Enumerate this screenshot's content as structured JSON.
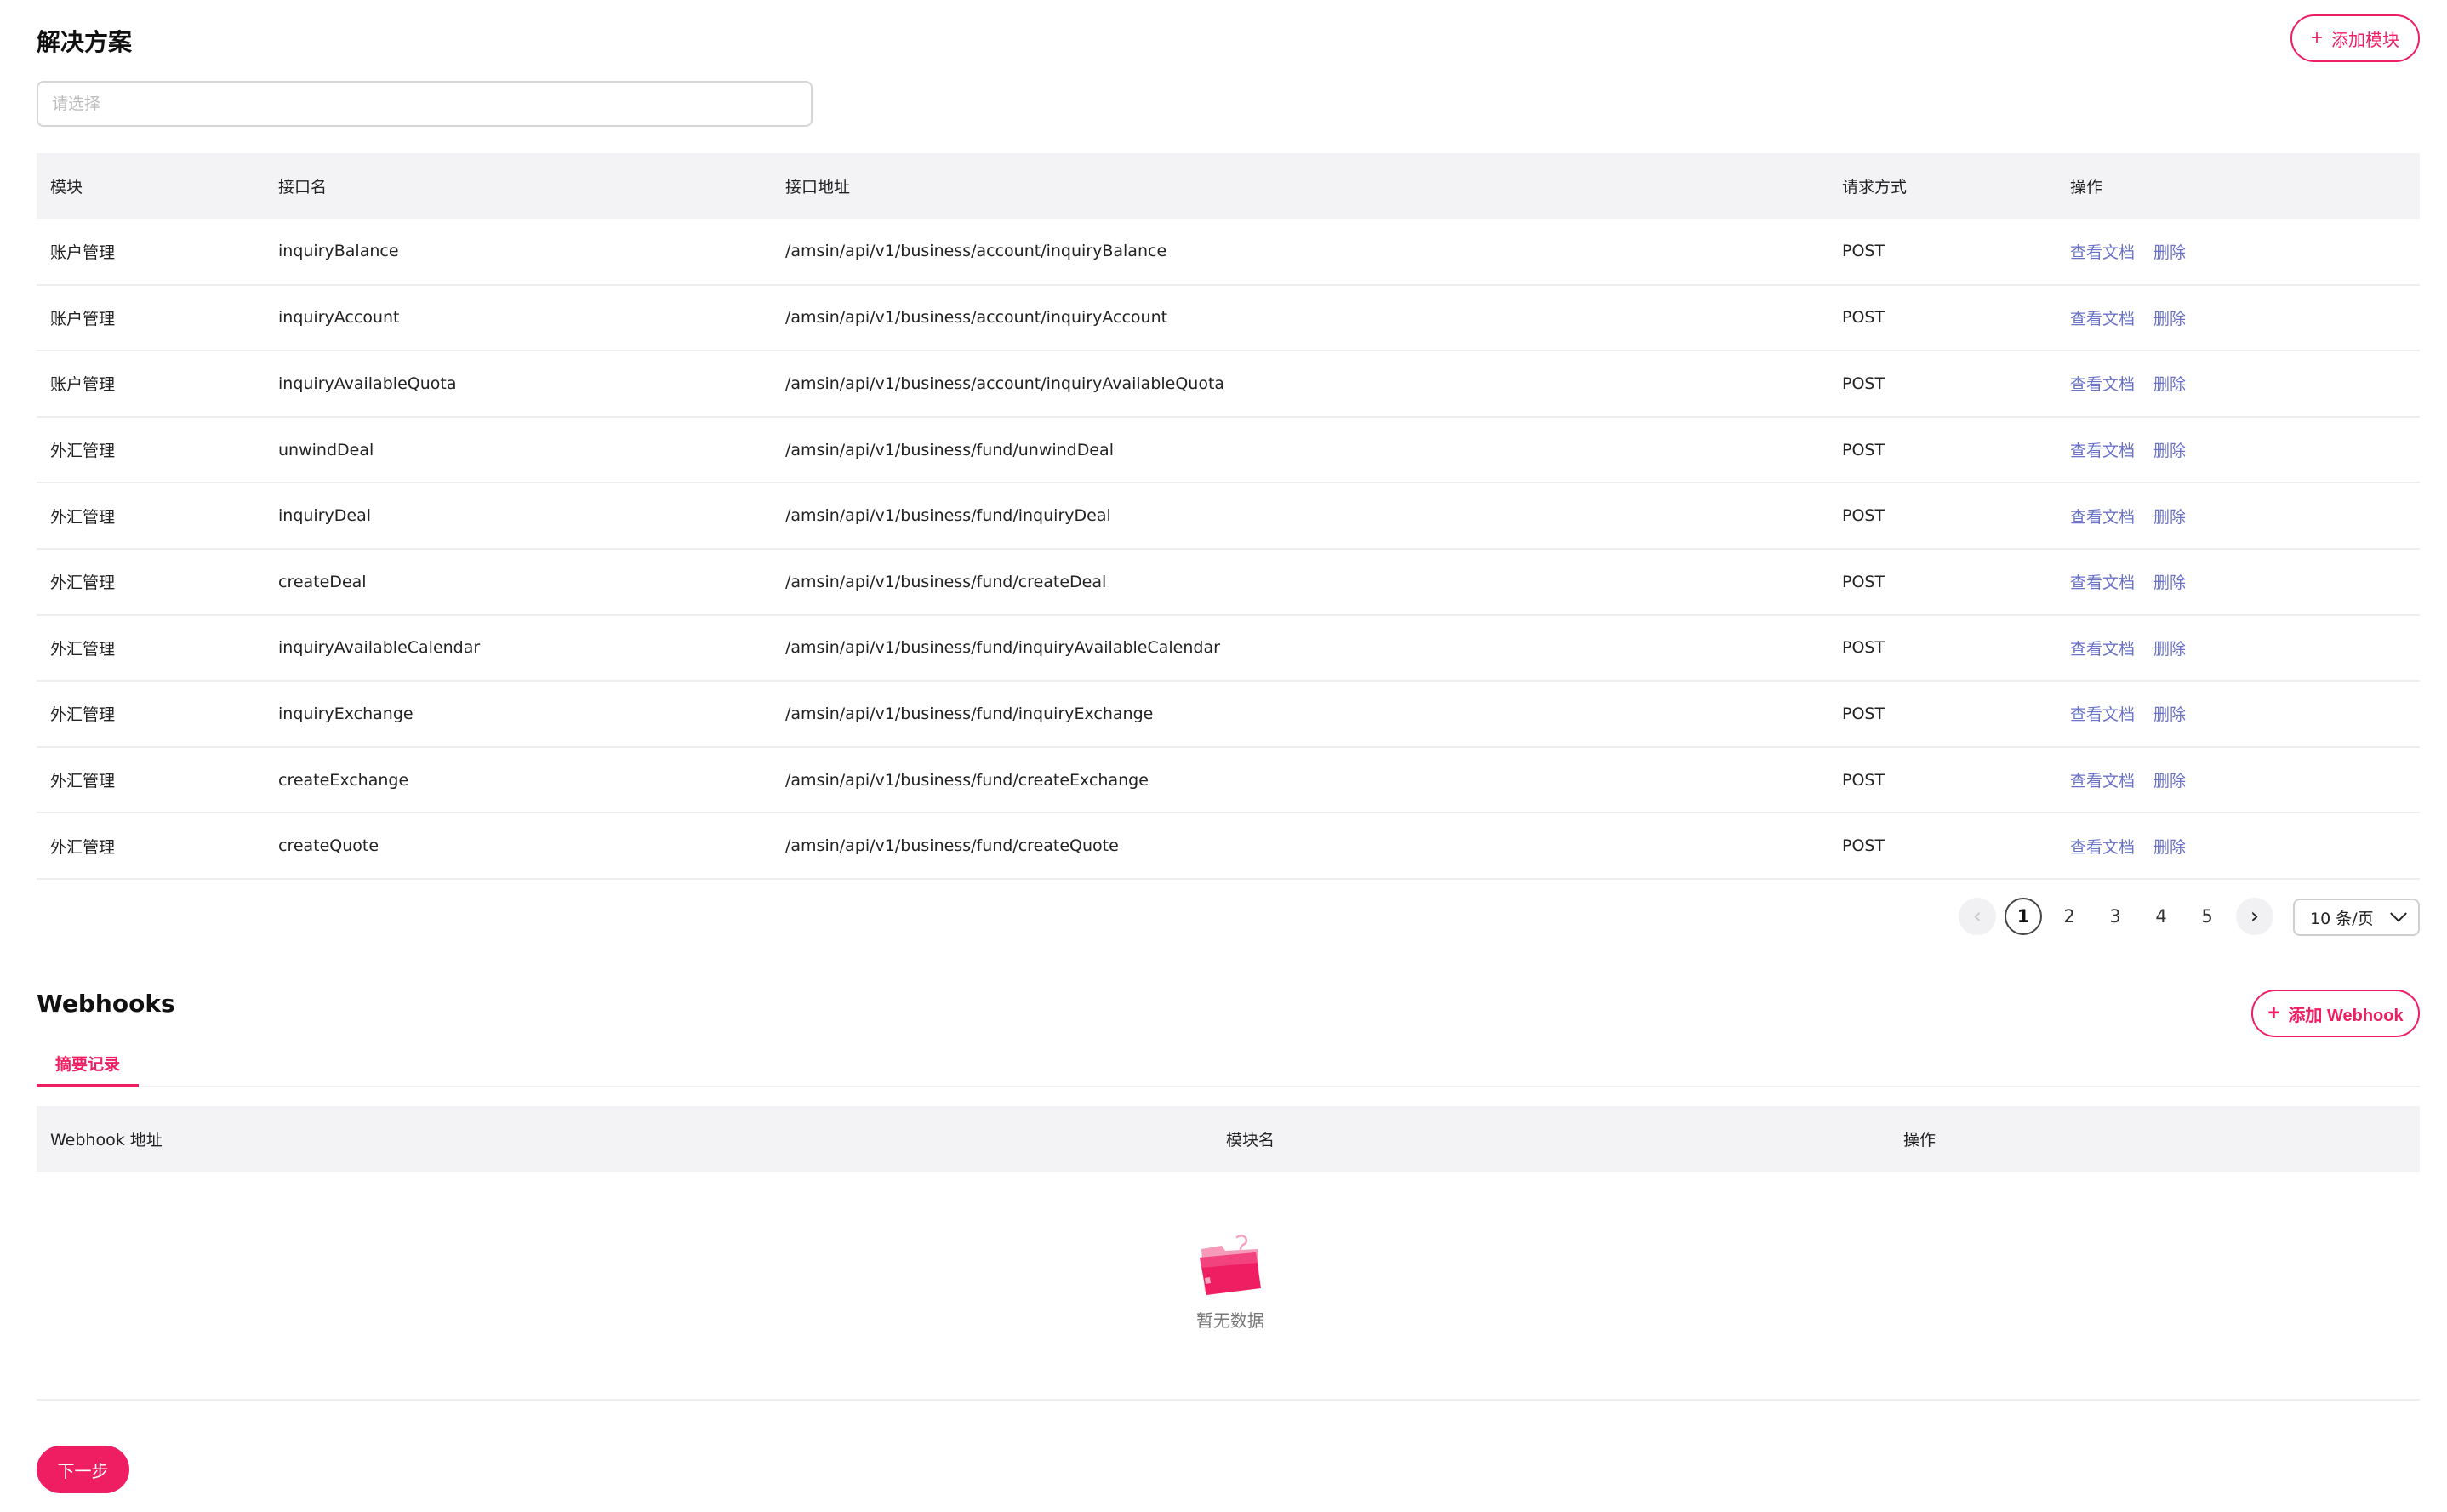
{
  "solution": {
    "title": "解决方案",
    "add_module_label": "添加模块",
    "select_placeholder": "请选择"
  },
  "api_table": {
    "headers": [
      "模块",
      "接口名",
      "接口地址",
      "请求方式",
      "操作"
    ],
    "actions": {
      "view_doc": "查看文档",
      "delete": "删除"
    },
    "rows": [
      {
        "module": "账户管理",
        "name": "inquiryBalance",
        "path": "/amsin/api/v1/business/account/inquiryBalance",
        "method": "POST"
      },
      {
        "module": "账户管理",
        "name": "inquiryAccount",
        "path": "/amsin/api/v1/business/account/inquiryAccount",
        "method": "POST"
      },
      {
        "module": "账户管理",
        "name": "inquiryAvailableQuota",
        "path": "/amsin/api/v1/business/account/inquiryAvailableQuota",
        "method": "POST"
      },
      {
        "module": "外汇管理",
        "name": "unwindDeal",
        "path": "/amsin/api/v1/business/fund/unwindDeal",
        "method": "POST"
      },
      {
        "module": "外汇管理",
        "name": "inquiryDeal",
        "path": "/amsin/api/v1/business/fund/inquiryDeal",
        "method": "POST"
      },
      {
        "module": "外汇管理",
        "name": "createDeal",
        "path": "/amsin/api/v1/business/fund/createDeal",
        "method": "POST"
      },
      {
        "module": "外汇管理",
        "name": "inquiryAvailableCalendar",
        "path": "/amsin/api/v1/business/fund/inquiryAvailableCalendar",
        "method": "POST"
      },
      {
        "module": "外汇管理",
        "name": "inquiryExchange",
        "path": "/amsin/api/v1/business/fund/inquiryExchange",
        "method": "POST"
      },
      {
        "module": "外汇管理",
        "name": "createExchange",
        "path": "/amsin/api/v1/business/fund/createExchange",
        "method": "POST"
      },
      {
        "module": "外汇管理",
        "name": "createQuote",
        "path": "/amsin/api/v1/business/fund/createQuote",
        "method": "POST"
      }
    ]
  },
  "pagination": {
    "pages": [
      "1",
      "2",
      "3",
      "4",
      "5"
    ],
    "current": "1",
    "page_size_label": "10 条/页"
  },
  "webhooks": {
    "title": "Webhooks",
    "add_label": "添加 Webhook",
    "tab_label": "摘要记录",
    "headers": [
      "Webhook 地址",
      "模块名",
      "操作"
    ],
    "empty_text": "暂无数据"
  },
  "footer": {
    "next_label": "下一步"
  },
  "colors": {
    "accent": "#ef1e63",
    "link": "#6a72c8",
    "header_bg": "#f3f3f6"
  },
  "icons": {
    "plus": "plus-icon",
    "prev": "chevron-left-icon",
    "next": "chevron-right-icon",
    "dropdown": "chevron-down-icon",
    "empty": "empty-folder-icon"
  }
}
